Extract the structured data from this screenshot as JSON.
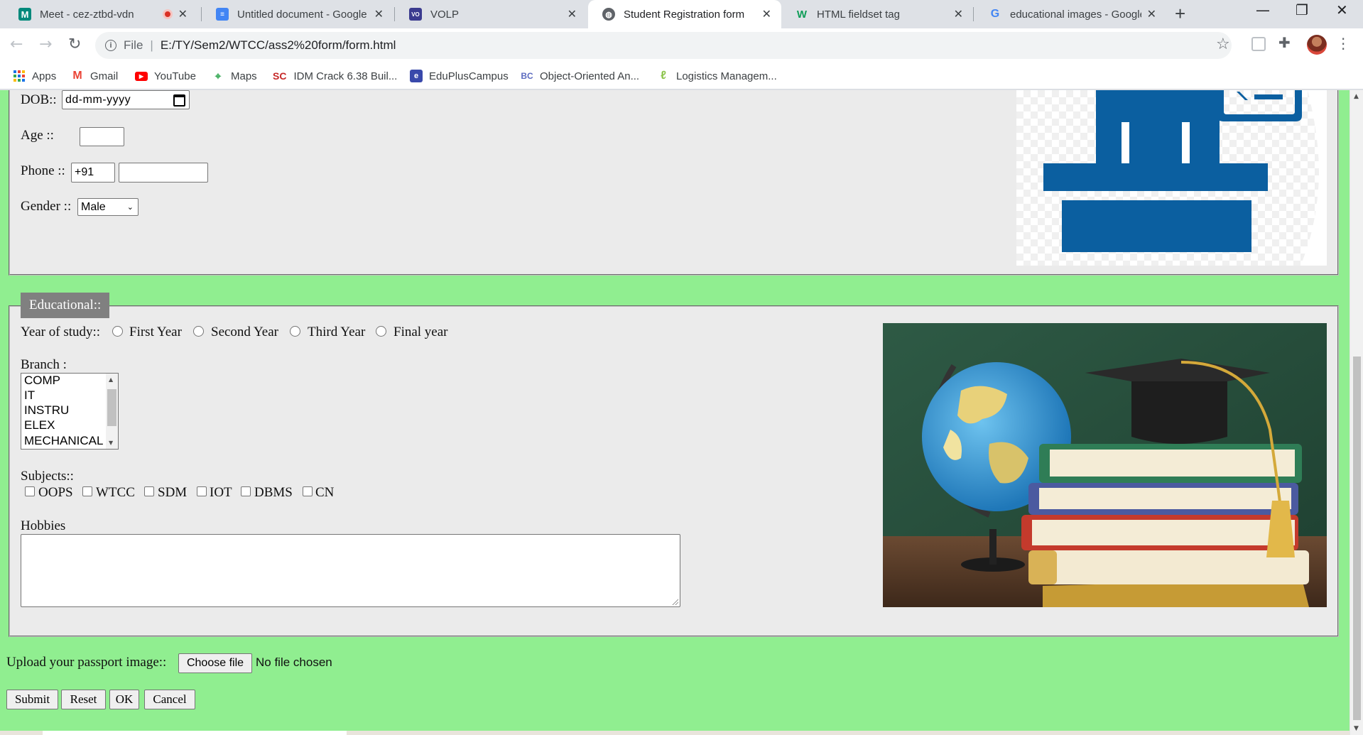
{
  "browser": {
    "tabs": [
      {
        "title": "Meet - cez-ztbd-vdn",
        "recording": true
      },
      {
        "title": "Untitled document - Google"
      },
      {
        "title": "VOLP"
      },
      {
        "title": "Student Registration form",
        "active": true
      },
      {
        "title": "HTML fieldset tag"
      },
      {
        "title": "educational images - Google"
      }
    ],
    "address": {
      "scheme": "File",
      "url": "E:/TY/Sem2/WTCC/ass2%20form/form.html"
    },
    "bookmarks": [
      {
        "label": "Apps",
        "icon": "apps-grid-icon"
      },
      {
        "label": "Gmail",
        "icon": "gmail-icon"
      },
      {
        "label": "YouTube",
        "icon": "youtube-icon"
      },
      {
        "label": "Maps",
        "icon": "maps-icon"
      },
      {
        "label": "IDM Crack 6.38 Buil...",
        "icon": "sc-icon",
        "icon_text": "SC"
      },
      {
        "label": "EduPlusCampus",
        "icon": "eduplus-icon"
      },
      {
        "label": "Object-Oriented An...",
        "icon": "bc-icon"
      },
      {
        "label": "Logistics Managem...",
        "icon": "leaf-icon"
      }
    ],
    "colors": {
      "page_bg": "#90ee90",
      "fieldset_bg": "#ebebeb",
      "legend_bg": "#808080"
    }
  },
  "personal": {
    "dob_label": "DOB::",
    "dob_placeholder": "dd-mm-yyyy",
    "age_label": "Age ::",
    "phone_label": "Phone ::",
    "phone_code": "+91",
    "gender_label": "Gender ::",
    "gender_value": "Male"
  },
  "educational": {
    "legend": "Educational::",
    "year_label": "Year of study::",
    "years": [
      "First Year",
      "Second Year",
      "Third Year",
      "Final year"
    ],
    "branch_label": "Branch :",
    "branches": [
      "COMP",
      "IT",
      "INSTRU",
      "ELEX",
      "MECHANICAL"
    ],
    "subjects_label": "Subjects::",
    "subjects": [
      "OOPS",
      "WTCC",
      "SDM",
      "IOT",
      "DBMS",
      "CN"
    ],
    "hobbies_label": "Hobbies"
  },
  "upload": {
    "label": "Upload your passport image::",
    "button": "Choose file",
    "status": "No file chosen"
  },
  "actions": [
    "Submit",
    "Reset",
    "OK",
    "Cancel"
  ]
}
